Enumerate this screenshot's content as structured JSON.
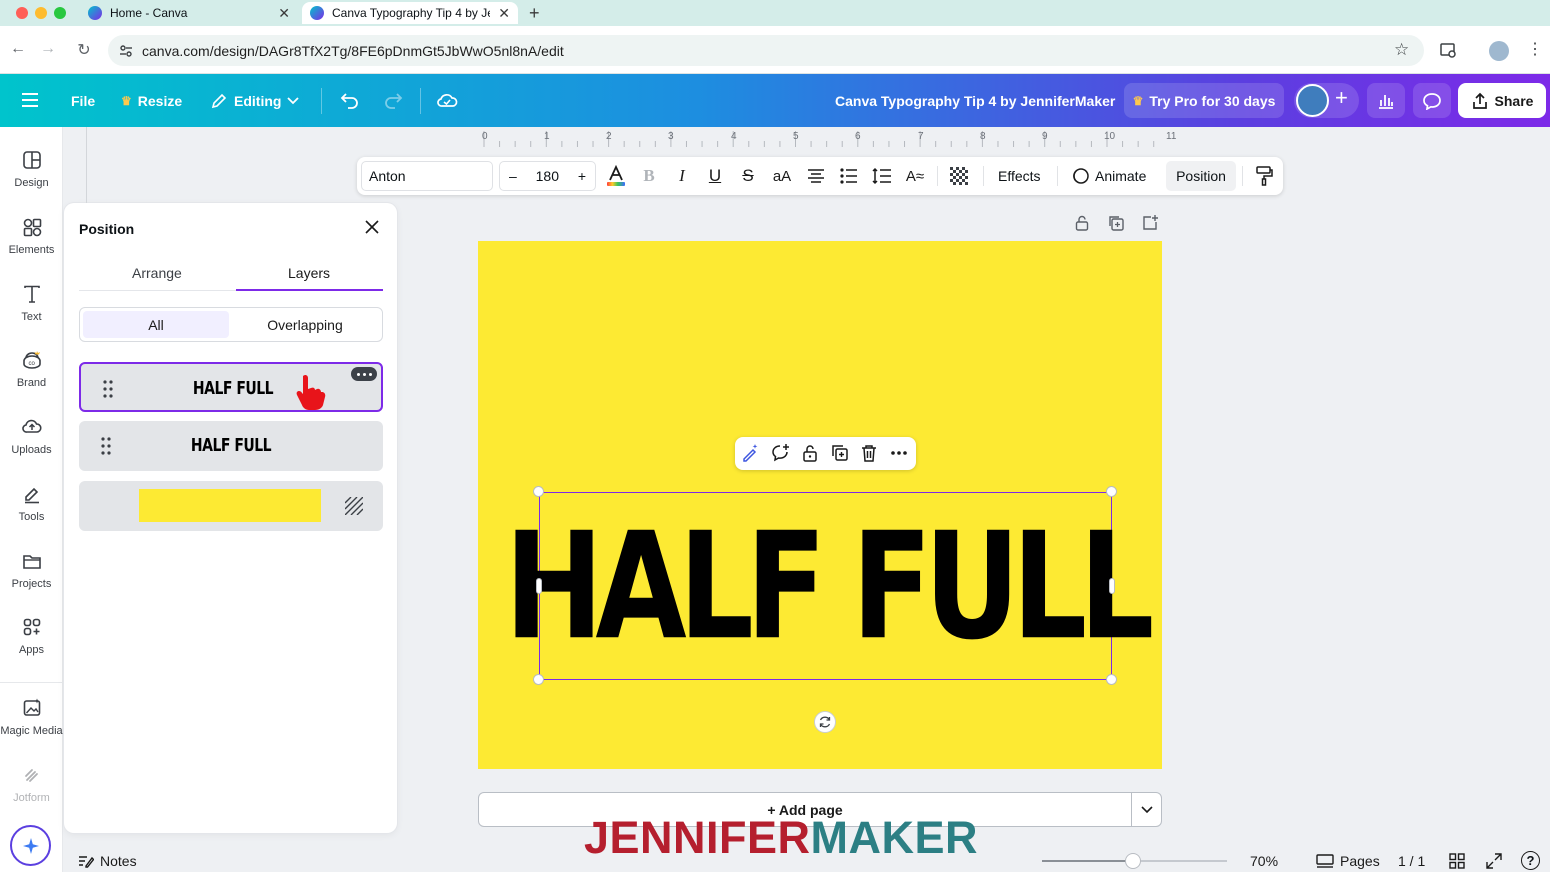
{
  "browser": {
    "tabs": [
      {
        "title": "Home - Canva",
        "active": false
      },
      {
        "title": "Canva Typography Tip 4 by Je",
        "active": true
      }
    ],
    "new_tab": "+",
    "url": "canva.com/design/DAGr8TfX2Tg/8FE6pDnmGt5JbWwO5nl8nA/edit"
  },
  "header": {
    "file": "File",
    "resize": "Resize",
    "editing": "Editing",
    "title": "Canva Typography Tip 4 by JenniferMaker",
    "try_pro": "Try Pro for 30 days",
    "share": "Share"
  },
  "rail": [
    {
      "label": "Design",
      "icon": "design-icon"
    },
    {
      "label": "Elements",
      "icon": "elements-icon"
    },
    {
      "label": "Text",
      "icon": "text-icon"
    },
    {
      "label": "Brand",
      "icon": "brand-icon"
    },
    {
      "label": "Uploads",
      "icon": "uploads-icon"
    },
    {
      "label": "Tools",
      "icon": "tools-icon"
    },
    {
      "label": "Projects",
      "icon": "projects-icon"
    },
    {
      "label": "Apps",
      "icon": "apps-icon"
    },
    {
      "label": "Magic Media",
      "icon": "magic-media-icon"
    },
    {
      "label": "Jotform",
      "icon": "jotform-icon"
    }
  ],
  "panel": {
    "title": "Position",
    "tabs": {
      "arrange": "Arrange",
      "layers": "Layers"
    },
    "filter": {
      "all": "All",
      "overlapping": "Overlapping"
    },
    "layers": [
      {
        "label": "HALF FULL",
        "selected": true
      },
      {
        "label": "HALF FULL",
        "selected": false
      },
      {
        "label": "",
        "type": "background"
      }
    ]
  },
  "toolbar": {
    "font": "Anton",
    "size": "180",
    "minus": "–",
    "plus": "+",
    "effects": "Effects",
    "animate": "Animate",
    "position": "Position"
  },
  "ruler": {
    "labels": [
      "0",
      "1",
      "2",
      "3",
      "4",
      "5",
      "6",
      "7",
      "8",
      "9",
      "10",
      "11"
    ]
  },
  "canvas": {
    "text": "HALF FULL",
    "background_color": "#fdea33",
    "add_page": "+ Add page"
  },
  "watermark": {
    "part1": "JENNIFER",
    "part2": "MAKER"
  },
  "bottom": {
    "notes": "Notes",
    "zoom": "70%",
    "zoom_level": 0.49,
    "pages": "Pages",
    "page_count": "1 / 1",
    "help": "?"
  },
  "colors": {
    "accent": "#7d2ae8",
    "brand_teal": "#00c4cc",
    "page": "#fdea33"
  }
}
